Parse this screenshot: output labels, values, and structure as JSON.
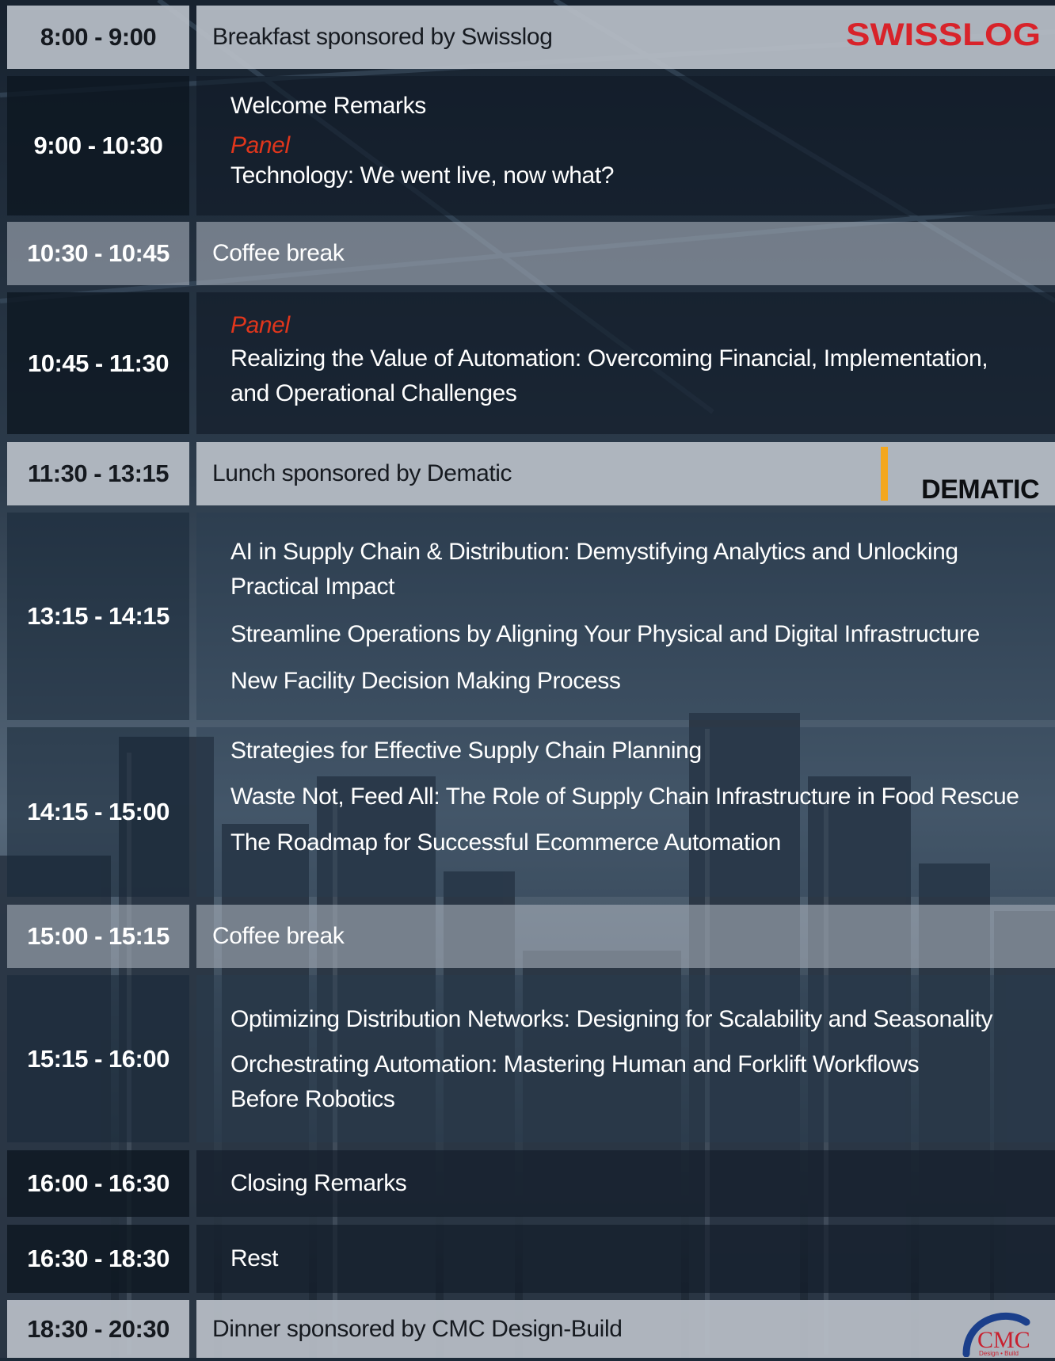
{
  "sponsors": {
    "swisslog_logo_text": "SWISSLOG",
    "dematic_logo_text": "DEMATIC",
    "cmc_logo_text": "CMC",
    "cmc_logo_subtext": "Design • Build",
    "swisslog_color": "#d8232a",
    "dematic_accent": "#f4a71d",
    "cmc_red": "#c8202f",
    "cmc_blue": "#1b3f8b"
  },
  "agenda": [
    {
      "time": "8:00 - 9:00",
      "title": "Breakfast sponsored by Swisslog"
    },
    {
      "time": "9:00 - 10:30",
      "welcome": "Welcome Remarks",
      "panel_tag": "Panel",
      "panel_title": "Technology: We went live, now what?"
    },
    {
      "time": "10:30 - 10:45",
      "title": "Coffee break"
    },
    {
      "time": "10:45 - 11:30",
      "panel_tag": "Panel",
      "panel_title_line1": "Realizing the Value of Automation: Overcoming Financial, Implementation,",
      "panel_title_line2": "and Operational Challenges"
    },
    {
      "time": "11:30 - 13:15",
      "title": "Lunch sponsored by Dematic"
    },
    {
      "time": "13:15 - 14:15",
      "s1_line1": "AI in Supply Chain & Distribution: Demystifying Analytics and Unlocking",
      "s1_line2": "Practical Impact",
      "s2": "Streamline Operations by Aligning Your Physical and Digital Infrastructure",
      "s3": "New Facility Decision Making Process"
    },
    {
      "time": "14:15 - 15:00",
      "s1": "Strategies for Effective Supply Chain Planning",
      "s2": "Waste Not, Feed All: The Role of Supply Chain Infrastructure in Food Rescue",
      "s3": "The Roadmap for Successful Ecommerce Automation"
    },
    {
      "time": "15:00 - 15:15",
      "title": "Coffee break"
    },
    {
      "time": "15:15 - 16:00",
      "s1": "Optimizing Distribution Networks: Designing for Scalability and Seasonality",
      "s2_line1": "Orchestrating Automation: Mastering Human and Forklift Workflows",
      "s2_line2": "Before Robotics"
    },
    {
      "time": "16:00 - 16:30",
      "title": "Closing Remarks"
    },
    {
      "time": "16:30 - 18:30",
      "title": "Rest"
    },
    {
      "time": "18:30 - 20:30",
      "title": "Dinner sponsored by CMC Design-Build"
    }
  ]
}
